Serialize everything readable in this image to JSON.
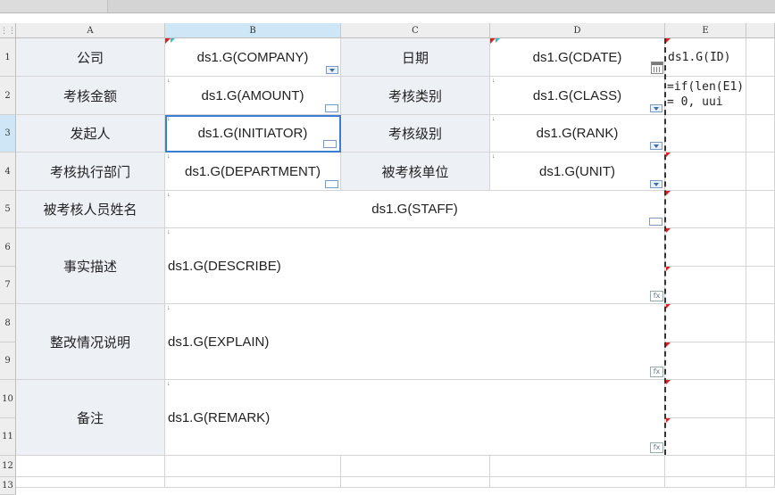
{
  "columns": [
    "A",
    "B",
    "C",
    "D",
    "E"
  ],
  "rows": [
    "1",
    "2",
    "3",
    "4",
    "5",
    "6",
    "7",
    "8",
    "9",
    "10",
    "11",
    "12",
    "13"
  ],
  "labels": {
    "company": "公司",
    "date": "日期",
    "amount": "考核金额",
    "assess_type": "考核类别",
    "initiator": "发起人",
    "assess_level": "考核级别",
    "exec_dept": "考核执行部门",
    "assessed_unit": "被考核单位",
    "assessed_staff": "被考核人员姓名",
    "fact_desc": "事实描述",
    "rectify": "整改情况说明",
    "remark": "备注"
  },
  "fields": {
    "company": "ds1.G(COMPANY)",
    "cdate": "ds1.G(CDATE)",
    "amount": "ds1.G(AMOUNT)",
    "class": "ds1.G(CLASS)",
    "initiator": "ds1.G(INITIATOR)",
    "rank": "ds1.G(RANK)",
    "department": "ds1.G(DEPARTMENT)",
    "unit": "ds1.G(UNIT)",
    "staff": "ds1.G(STAFF)",
    "describe": "ds1.G(DESCRIBE)",
    "explain": "ds1.G(EXPLAIN)",
    "remark": "ds1.G(REMARK)",
    "id": "ds1.G(ID)",
    "formula": "=if(len(E1) = 0, uui"
  },
  "icons": {
    "fx": "fx"
  },
  "colors": {
    "selection": "#3b7ed1",
    "label_bg": "#edf0f5",
    "marker": "#e02020"
  }
}
